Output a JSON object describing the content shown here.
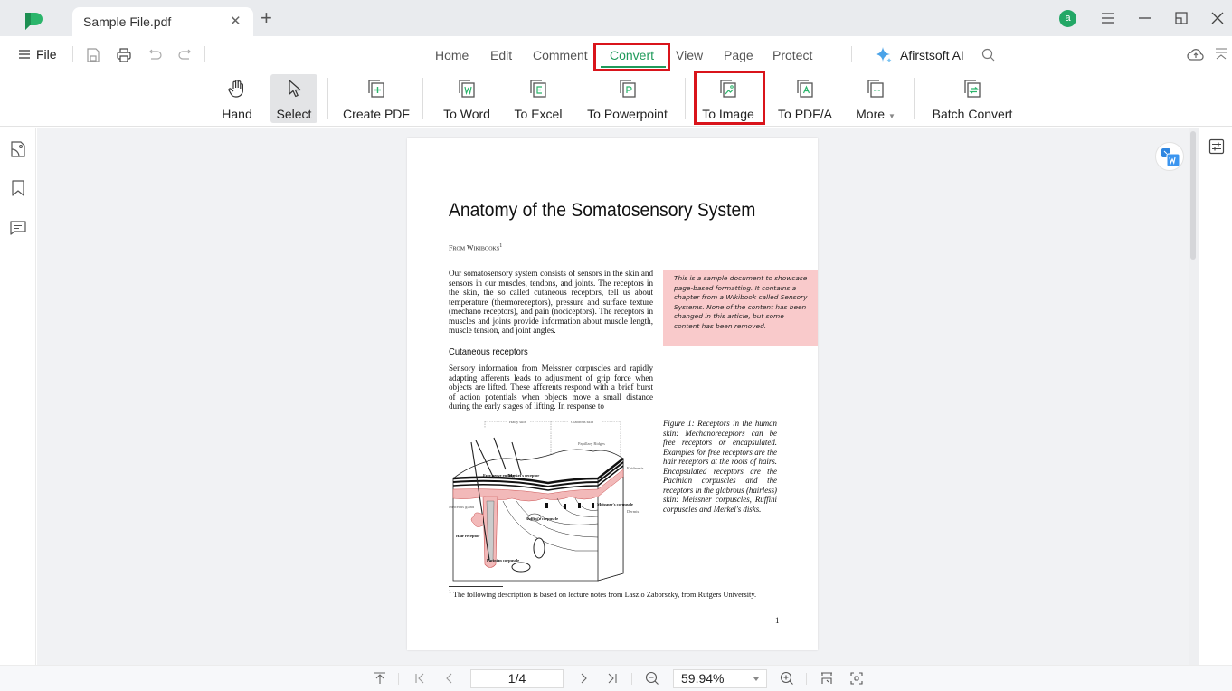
{
  "window": {
    "tab_title": "Sample File.pdf",
    "avatar_letter": "a",
    "accent_color": "#1f9a5a",
    "highlight_color": "#d9141b"
  },
  "menu": {
    "file_label": "File",
    "tabs": [
      {
        "label": "Home"
      },
      {
        "label": "Edit"
      },
      {
        "label": "Comment"
      },
      {
        "label": "Convert",
        "active": true
      },
      {
        "label": "View"
      },
      {
        "label": "Page"
      },
      {
        "label": "Protect"
      }
    ],
    "ai_label": "Afirstsoft AI"
  },
  "toolbar": {
    "hand": "Hand",
    "select": "Select",
    "create_pdf": "Create PDF",
    "to_word": "To Word",
    "to_excel": "To Excel",
    "to_powerpoint": "To Powerpoint",
    "to_image": "To Image",
    "to_pdfa": "To PDF/A",
    "more": "More",
    "batch_convert": "Batch Convert"
  },
  "document": {
    "title": "Anatomy of the Somatosensory System",
    "from": "From Wikibooks",
    "from_sup": "1",
    "intro": "Our somatosensory system consists of sensors in the skin and sensors in our muscles, tendons, and joints. The receptors in the skin, the so called cutaneous receptors, tell us about temperature (thermoreceptors), pressure and surface texture (mechano receptors), and pain (nociceptors). The receptors in muscles and joints provide information about muscle length, muscle tension, and joint angles.",
    "note": "This is a sample document to showcase page-based formatting. It contains a chapter from a Wikibook called Sensory Systems. None of the content has been changed in this article, but some content has been removed.",
    "subheading": "Cutaneous receptors",
    "cutaneous": "Sensory information from Meissner corpuscles and rapidly adapting afferents leads to adjustment of grip force when objects are lifted. These afferents respond with a brief burst of action potentials when objects move a small distance during the early stages of lifting. In response to",
    "figure_caption": "Figure 1: Receptors in the human skin: Mechanoreceptors can be free receptors or encapsulated. Examples for free receptors are the hair receptors at the roots of hairs. Encapsulated receptors are the Pacinian corpuscles and the receptors in the glabrous (hairless) skin: Meissner corpuscles, Ruffini corpuscles and Merkel's disks.",
    "figure_labels": {
      "hairy_skin": "Hairy skin",
      "glabrous_skin": "Glabrous skin",
      "papillary_ridges": "Papillary Ridges",
      "epidermis": "Epidermis",
      "dermis": "Dermis",
      "free_nerve": "Free nerve ending",
      "merkels": "Merkel's receptor",
      "sebaceous": "Sebaceous gland",
      "ruffinis": "Ruffini's corpuscle",
      "meissners": "Meissner's corpuscle",
      "hair_receptor": "Hair receptor",
      "pacinian": "Pacinian corpuscle"
    },
    "footnote_sup": "1",
    "footnote": "The following description is based on lecture notes from Laszlo Zaborszky, from Rutgers University.",
    "page_number": "1"
  },
  "statusbar": {
    "page_indicator": "1/4",
    "zoom_level": "59.94%"
  }
}
